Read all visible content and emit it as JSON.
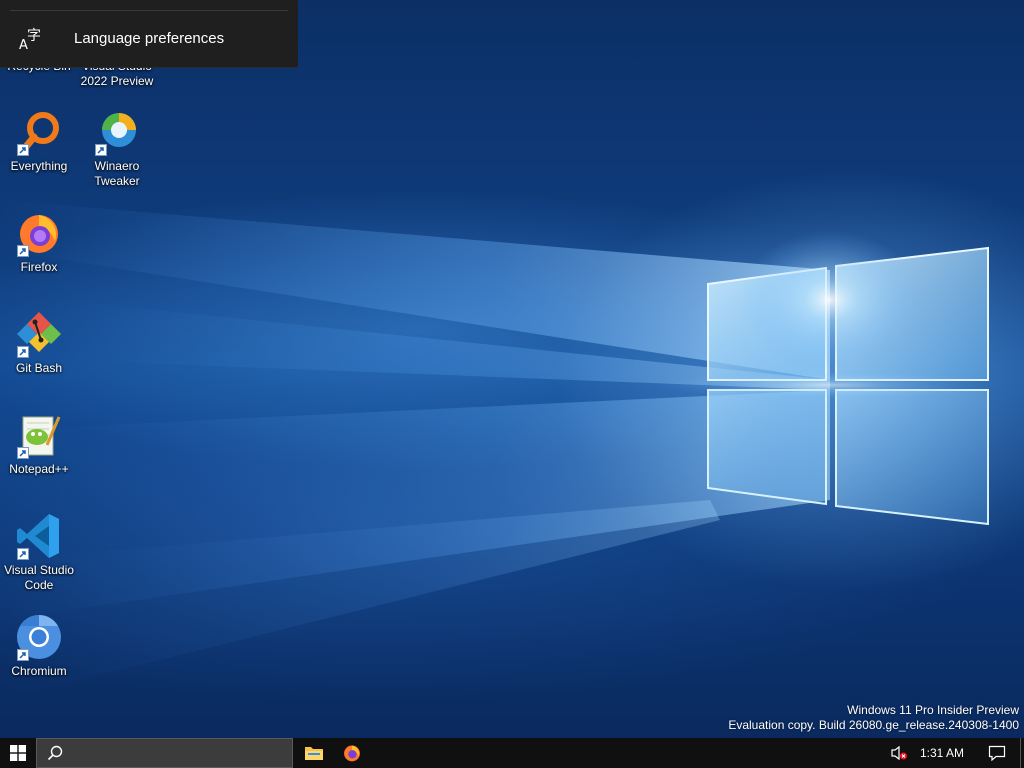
{
  "flyout": {
    "items": [
      {
        "label": "Language preferences",
        "icon": "language-icon"
      }
    ]
  },
  "desktop": {
    "icons": [
      {
        "label": "Recycle Bin",
        "icon": "recycle-bin-icon"
      },
      {
        "label": "Visual Studio\n2022 Preview",
        "icon": "visual-studio-icon"
      },
      {
        "label": "Everything",
        "icon": "everything-search-icon"
      },
      {
        "label": "Winaero\nTweaker",
        "icon": "winaero-tweaker-icon"
      },
      {
        "label": "Firefox",
        "icon": "firefox-icon"
      },
      {
        "label": "Git Bash",
        "icon": "git-bash-icon"
      },
      {
        "label": "Notepad++",
        "icon": "notepad-plus-plus-icon"
      },
      {
        "label": "Visual Studio\nCode",
        "icon": "vscode-icon"
      },
      {
        "label": "Chromium",
        "icon": "chromium-icon"
      }
    ]
  },
  "watermark": {
    "line1": "Windows 11 Pro Insider Preview",
    "line2": "Evaluation copy. Build 26080.ge_release.240308-1400"
  },
  "taskbar": {
    "search_placeholder": "",
    "apps": [
      {
        "name": "File Explorer",
        "icon": "file-explorer-icon"
      },
      {
        "name": "Firefox",
        "icon": "firefox-icon"
      }
    ],
    "clock": "1:31 AM",
    "volume": "muted",
    "colors": {
      "background": "#101010",
      "search_bg": "#3c3c3c"
    }
  },
  "colors": {
    "wallpaper_base": "#0f3d7e",
    "wallpaper_glow": "#8fd0ff",
    "flyout_bg": "#1f1f1f"
  }
}
